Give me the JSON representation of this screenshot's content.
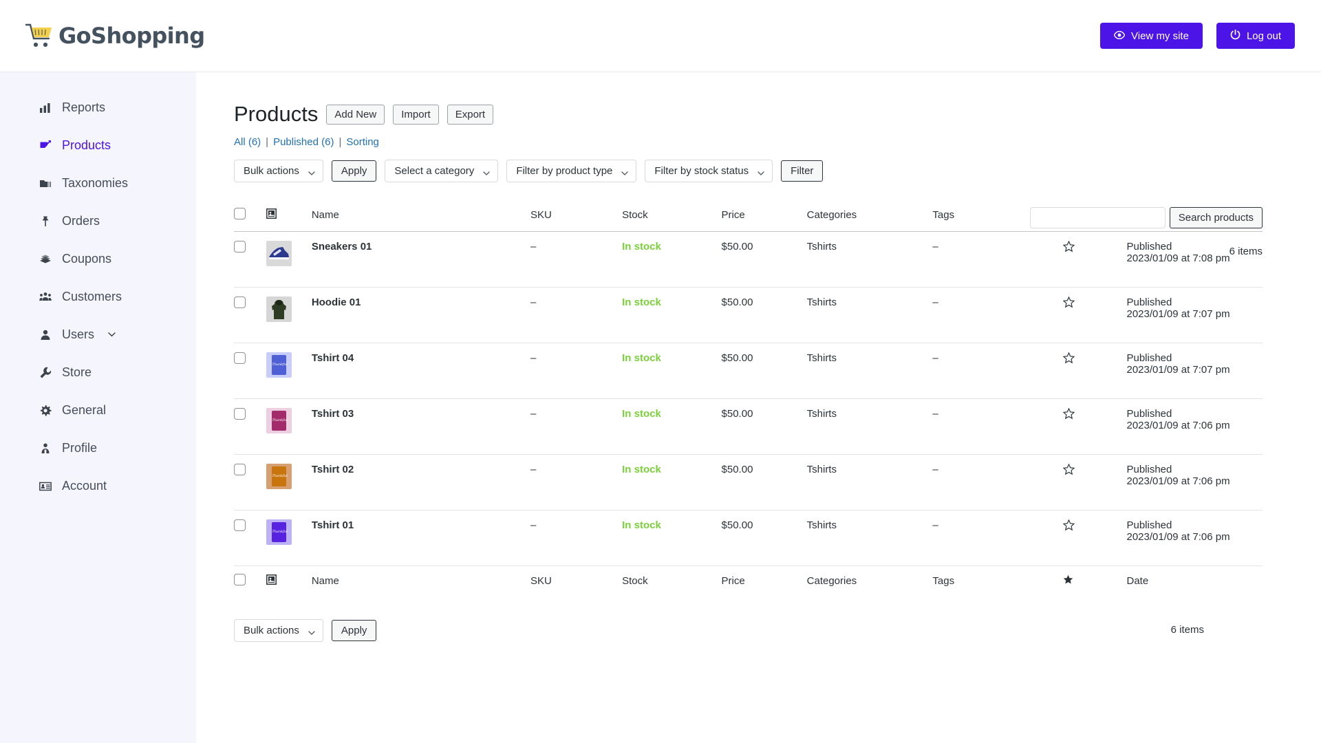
{
  "brand": {
    "name": "GoShopping",
    "logo_icon": "shopping-cart-icon",
    "cart_color": "#f4cf4a",
    "text_color": "#44515e"
  },
  "topbar": {
    "view_site_label": "View my site",
    "view_site_icon": "eye-icon",
    "logout_label": "Log out",
    "logout_icon": "power-icon",
    "accent_color": "#4d14e8"
  },
  "sidebar": {
    "items": [
      {
        "label": "Reports",
        "icon": "bar-chart-icon",
        "active": false,
        "has_caret": false
      },
      {
        "label": "Products",
        "icon": "edit-square-icon",
        "active": true,
        "has_caret": false
      },
      {
        "label": "Taxonomies",
        "icon": "folder-icon",
        "active": false,
        "has_caret": false
      },
      {
        "label": "Orders",
        "icon": "pin-icon",
        "active": false,
        "has_caret": false
      },
      {
        "label": "Coupons",
        "icon": "coupons-icon",
        "active": false,
        "has_caret": false
      },
      {
        "label": "Customers",
        "icon": "group-icon",
        "active": false,
        "has_caret": false
      },
      {
        "label": "Users",
        "icon": "user-icon",
        "active": false,
        "has_caret": true
      },
      {
        "label": "Store",
        "icon": "wrench-icon",
        "active": false,
        "has_caret": false
      },
      {
        "label": "General",
        "icon": "gear-icon",
        "active": false,
        "has_caret": false
      },
      {
        "label": "Profile",
        "icon": "profile-icon",
        "active": false,
        "has_caret": false
      },
      {
        "label": "Account",
        "icon": "id-card-icon",
        "active": false,
        "has_caret": false
      }
    ]
  },
  "page": {
    "title": "Products",
    "add_new_label": "Add New",
    "import_label": "Import",
    "export_label": "Export",
    "views": [
      {
        "label": "All (6)"
      },
      {
        "label": "Published (6)"
      },
      {
        "label": "Sorting"
      }
    ],
    "view_separator": "|"
  },
  "filters": {
    "bulk_actions_label": "Bulk actions",
    "apply_label": "Apply",
    "category_label": "Select a category",
    "product_type_label": "Filter by product type",
    "stock_status_label": "Filter by stock status",
    "filter_label": "Filter"
  },
  "search": {
    "value": "",
    "placeholder": "",
    "button_label": "Search products"
  },
  "counts": {
    "top_items": "6 items",
    "bottom_items": "6 items"
  },
  "table": {
    "columns": [
      "",
      "",
      "Name",
      "SKU",
      "Stock",
      "Price",
      "Categories",
      "Tags",
      "",
      "Date"
    ],
    "headers": {
      "name": "Name",
      "sku": "SKU",
      "stock": "Stock",
      "price": "Price",
      "categories": "Categories",
      "tags": "Tags",
      "date": "Date",
      "image_icon": "image-icon",
      "star_icon": "star-filled-icon"
    },
    "rows": [
      {
        "name": "Sneakers 01",
        "sku": "–",
        "stock": "In stock",
        "price": "$50.00",
        "categories": "Tshirts",
        "tags": "–",
        "featured": false,
        "status": "Published",
        "date": "2023/01/09 at 7:08 pm",
        "thumb_type": "sneaker",
        "thumb_bg": "#d9d9d9",
        "thumb_color": "#2b3a8f"
      },
      {
        "name": "Hoodie 01",
        "sku": "–",
        "stock": "In stock",
        "price": "$50.00",
        "categories": "Tshirts",
        "tags": "–",
        "featured": false,
        "status": "Published",
        "date": "2023/01/09 at 7:07 pm",
        "thumb_type": "hoodie",
        "thumb_bg": "#d6d6d6",
        "thumb_color": "#2e3c23"
      },
      {
        "name": "Tshirt 04",
        "sku": "–",
        "stock": "In stock",
        "price": "$50.00",
        "categories": "Tshirts",
        "tags": "–",
        "featured": false,
        "status": "Published",
        "date": "2023/01/09 at 7:07 pm",
        "thumb_type": "tshirt",
        "thumb_bg": "#c8cdfa",
        "thumb_color": "#4f5fd6"
      },
      {
        "name": "Tshirt 03",
        "sku": "–",
        "stock": "In stock",
        "price": "$50.00",
        "categories": "Tshirts",
        "tags": "–",
        "featured": false,
        "status": "Published",
        "date": "2023/01/09 at 7:06 pm",
        "thumb_type": "tshirt",
        "thumb_bg": "#eccfe0",
        "thumb_color": "#a32a6b"
      },
      {
        "name": "Tshirt 02",
        "sku": "–",
        "stock": "In stock",
        "price": "$50.00",
        "categories": "Tshirts",
        "tags": "–",
        "featured": false,
        "status": "Published",
        "date": "2023/01/09 at 7:06 pm",
        "thumb_type": "tshirt",
        "thumb_bg": "#d7a072",
        "thumb_color": "#c8750d"
      },
      {
        "name": "Tshirt 01",
        "sku": "–",
        "stock": "In stock",
        "price": "$50.00",
        "categories": "Tshirts",
        "tags": "–",
        "featured": false,
        "status": "Published",
        "date": "2023/01/09 at 7:06 pm",
        "thumb_type": "tshirt",
        "thumb_bg": "#bdb2f5",
        "thumb_color": "#5722e0"
      }
    ]
  },
  "bottom": {
    "bulk_actions_label": "Bulk actions",
    "apply_label": "Apply"
  },
  "colors": {
    "accent": "#4d14e8",
    "sidebar_bg": "#f5f6fd",
    "instock_green": "#7ad03a",
    "link_blue": "#2271b1"
  }
}
